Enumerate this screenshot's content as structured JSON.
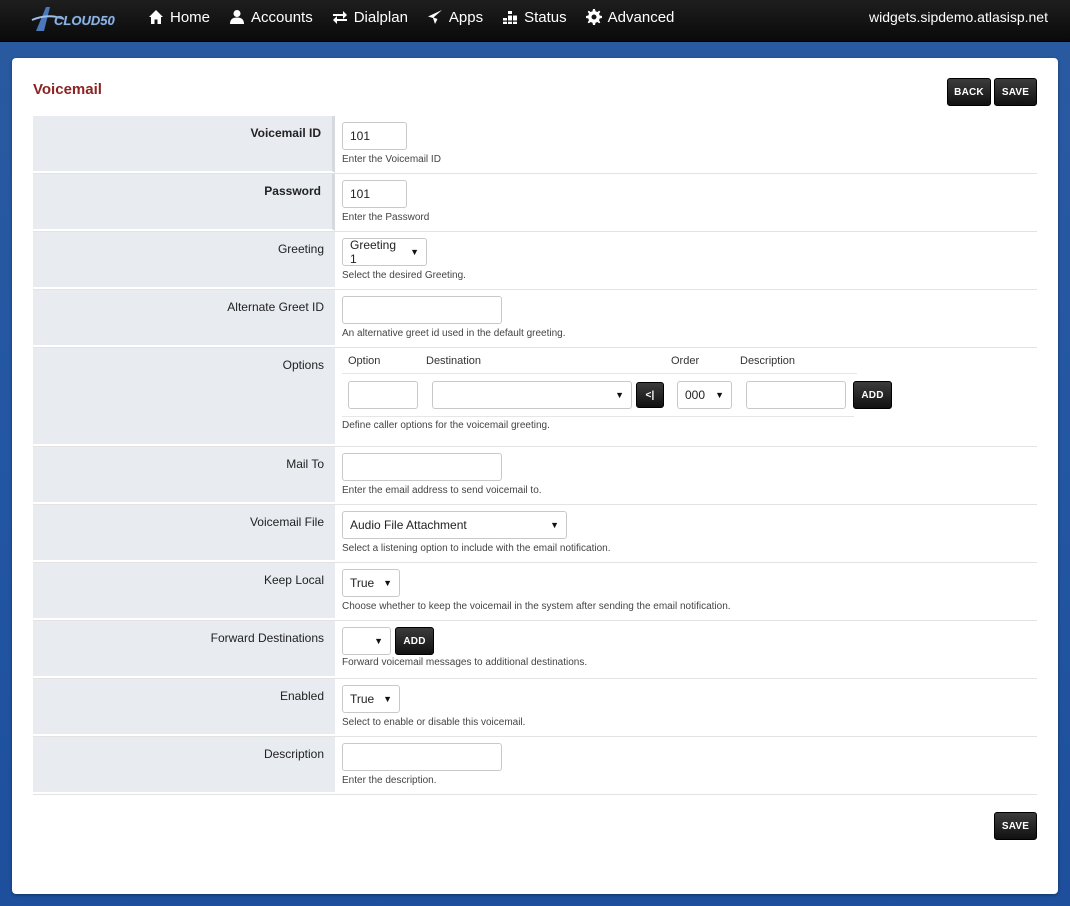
{
  "brand": {
    "logo_text": "CLOUD50"
  },
  "nav": {
    "items": [
      {
        "label": "Home",
        "icon": "home-icon"
      },
      {
        "label": "Accounts",
        "icon": "user-icon"
      },
      {
        "label": "Dialplan",
        "icon": "transfer-icon"
      },
      {
        "label": "Apps",
        "icon": "send-icon"
      },
      {
        "label": "Status",
        "icon": "chart-icon"
      },
      {
        "label": "Advanced",
        "icon": "gear-icon"
      }
    ],
    "domain": "widgets.sipdemo.atlasisp.net"
  },
  "page": {
    "title": "Voicemail",
    "back_label": "BACK",
    "save_label": "SAVE"
  },
  "form": {
    "voicemail_id": {
      "label": "Voicemail ID",
      "value": "101",
      "hint": "Enter the Voicemail ID"
    },
    "password": {
      "label": "Password",
      "value": "101",
      "hint": "Enter the Password"
    },
    "greeting": {
      "label": "Greeting",
      "value": "Greeting 1",
      "hint": "Select the desired Greeting."
    },
    "alternate_greet_id": {
      "label": "Alternate Greet ID",
      "value": "",
      "hint": "An alternative greet id used in the default greeting."
    },
    "options": {
      "label": "Options",
      "columns": [
        "Option",
        "Destination",
        "Order",
        "Description"
      ],
      "order_value": "000",
      "back_btn": "<|",
      "add_label": "ADD",
      "hint": "Define caller options for the voicemail greeting."
    },
    "mail_to": {
      "label": "Mail To",
      "value": "",
      "hint": "Enter the email address to send voicemail to."
    },
    "voicemail_file": {
      "label": "Voicemail File",
      "value": "Audio File Attachment",
      "hint": "Select a listening option to include with the email notification."
    },
    "keep_local": {
      "label": "Keep Local",
      "value": "True",
      "hint": "Choose whether to keep the voicemail in the system after sending the email notification."
    },
    "forward_destinations": {
      "label": "Forward Destinations",
      "value": "",
      "add_label": "ADD",
      "hint": "Forward voicemail messages to additional destinations."
    },
    "enabled": {
      "label": "Enabled",
      "value": "True",
      "hint": "Select to enable or disable this voicemail."
    },
    "description": {
      "label": "Description",
      "value": "",
      "hint": "Enter the description."
    }
  }
}
